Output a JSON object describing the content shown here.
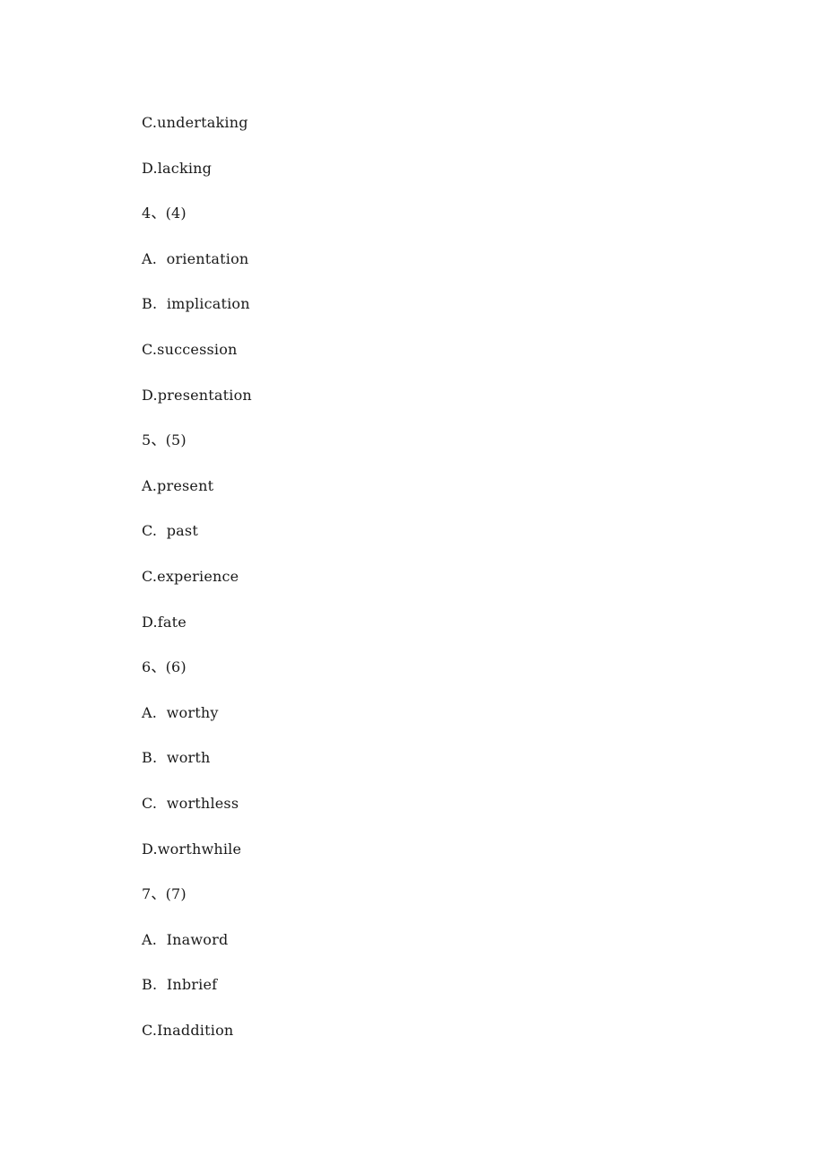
{
  "lines": [
    {
      "type": "option",
      "text": "C.undertaking"
    },
    {
      "type": "option",
      "text": "D.lacking"
    },
    {
      "type": "question",
      "text": "4、(4)"
    },
    {
      "type": "option",
      "text": "A.  orientation"
    },
    {
      "type": "option",
      "text": "B.  implication"
    },
    {
      "type": "option",
      "text": "C.succession"
    },
    {
      "type": "option",
      "text": "D.presentation"
    },
    {
      "type": "question",
      "text": "5、(5)"
    },
    {
      "type": "option",
      "text": "A.present"
    },
    {
      "type": "option",
      "text": "C.  past"
    },
    {
      "type": "option",
      "text": "C.experience"
    },
    {
      "type": "option",
      "text": "D.fate"
    },
    {
      "type": "question",
      "text": "6、(6)"
    },
    {
      "type": "option",
      "text": "A.  worthy"
    },
    {
      "type": "option",
      "text": "B.  worth"
    },
    {
      "type": "option",
      "text": "C.  worthless"
    },
    {
      "type": "option",
      "text": "D.worthwhile"
    },
    {
      "type": "question",
      "text": "7、(7)"
    },
    {
      "type": "option",
      "text": "A.  Inaword"
    },
    {
      "type": "option",
      "text": "B.  Inbrief"
    },
    {
      "type": "option",
      "text": "C.Inaddition"
    }
  ]
}
